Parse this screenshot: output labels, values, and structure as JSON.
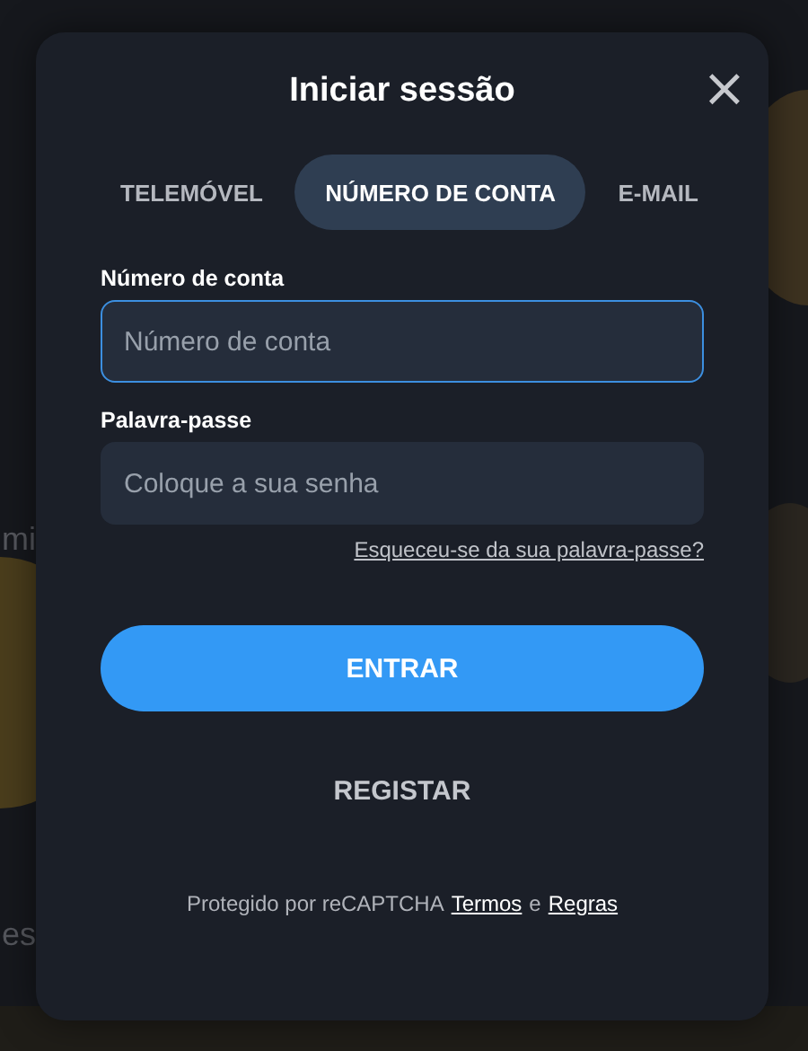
{
  "background": {
    "kind": "picture",
    "texts": [
      "mi",
      "es"
    ]
  },
  "dialog": {
    "title": "Iniciar sessão",
    "close": "×",
    "tabs": [
      {
        "label": "TELEMÓVEL",
        "selected": false
      },
      {
        "label": "NÚMERO DE CONTA",
        "selected": true
      },
      {
        "label": "E-MAIL",
        "selected": false
      }
    ],
    "fields": [
      {
        "label": "Número de conta",
        "placeholder": "Número de conta",
        "focused": true
      },
      {
        "label": "Palavra-passe",
        "placeholder": "Coloque a sua senha",
        "focused": false
      }
    ],
    "forgot_link": "Esqueceu-se da sua palavra-passe?",
    "submit_button": "ENTRAR",
    "register_button": "REGISTAR",
    "footer": {
      "text": "Protegido por reCAPTCHA",
      "terms_link": "Termos",
      "conjunction": "e",
      "rules_link": "Regras"
    }
  }
}
